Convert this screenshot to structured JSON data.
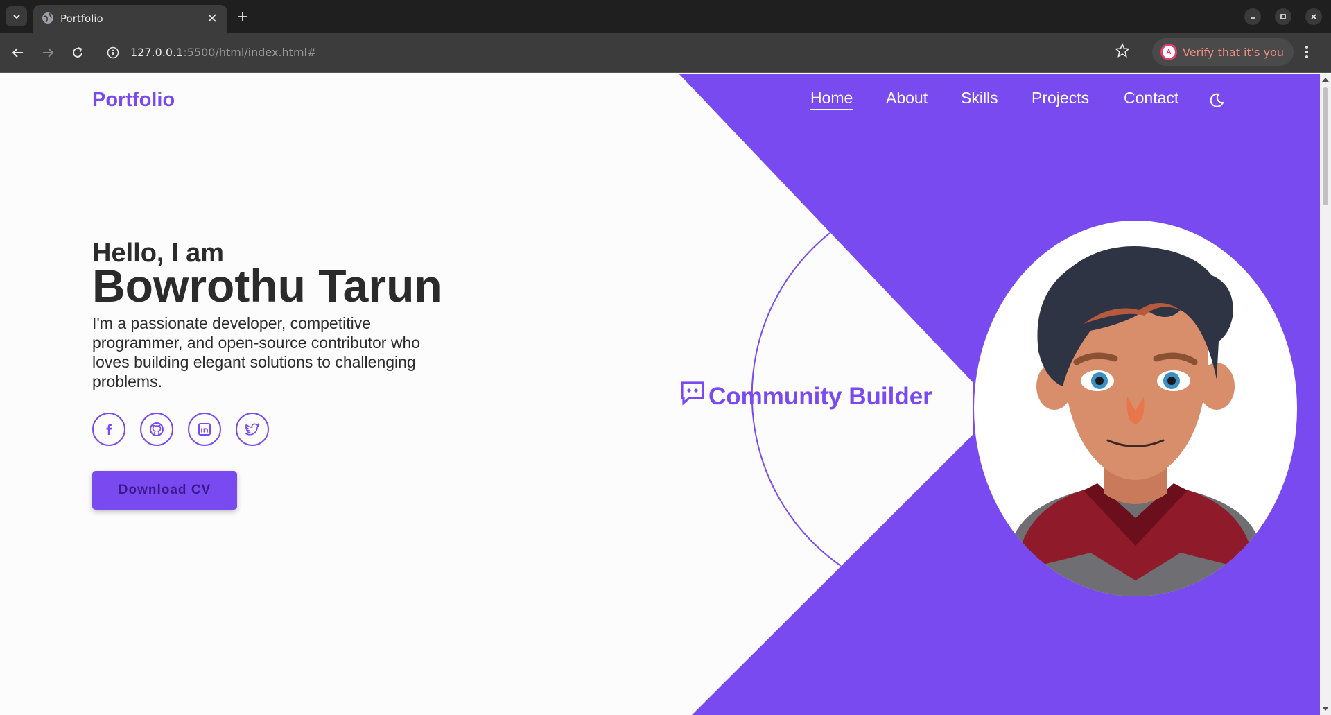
{
  "browser": {
    "tab_title": "Portfolio",
    "url_host": "127.0.0.1",
    "url_rest": ":5500/html/index.html#",
    "verify_label": "Verify that it's you",
    "profile_initial": "A"
  },
  "site": {
    "logo": "Portfolio",
    "nav": [
      "Home",
      "About",
      "Skills",
      "Projects",
      "Contact"
    ],
    "active_nav": "Home",
    "hero": {
      "greeting": "Hello, I am",
      "name": "Bowrothu Tarun",
      "description": "I'm a passionate developer, competitive programmer, and open-source contributor who loves building elegant solutions to challenging problems.",
      "cta": "Download CV",
      "role": "Community Builder"
    },
    "social": [
      "facebook",
      "github",
      "linkedin",
      "twitter"
    ]
  },
  "colors": {
    "accent": "#7a4af1",
    "text": "#2b2b2b",
    "background": "#fcfcfc"
  }
}
